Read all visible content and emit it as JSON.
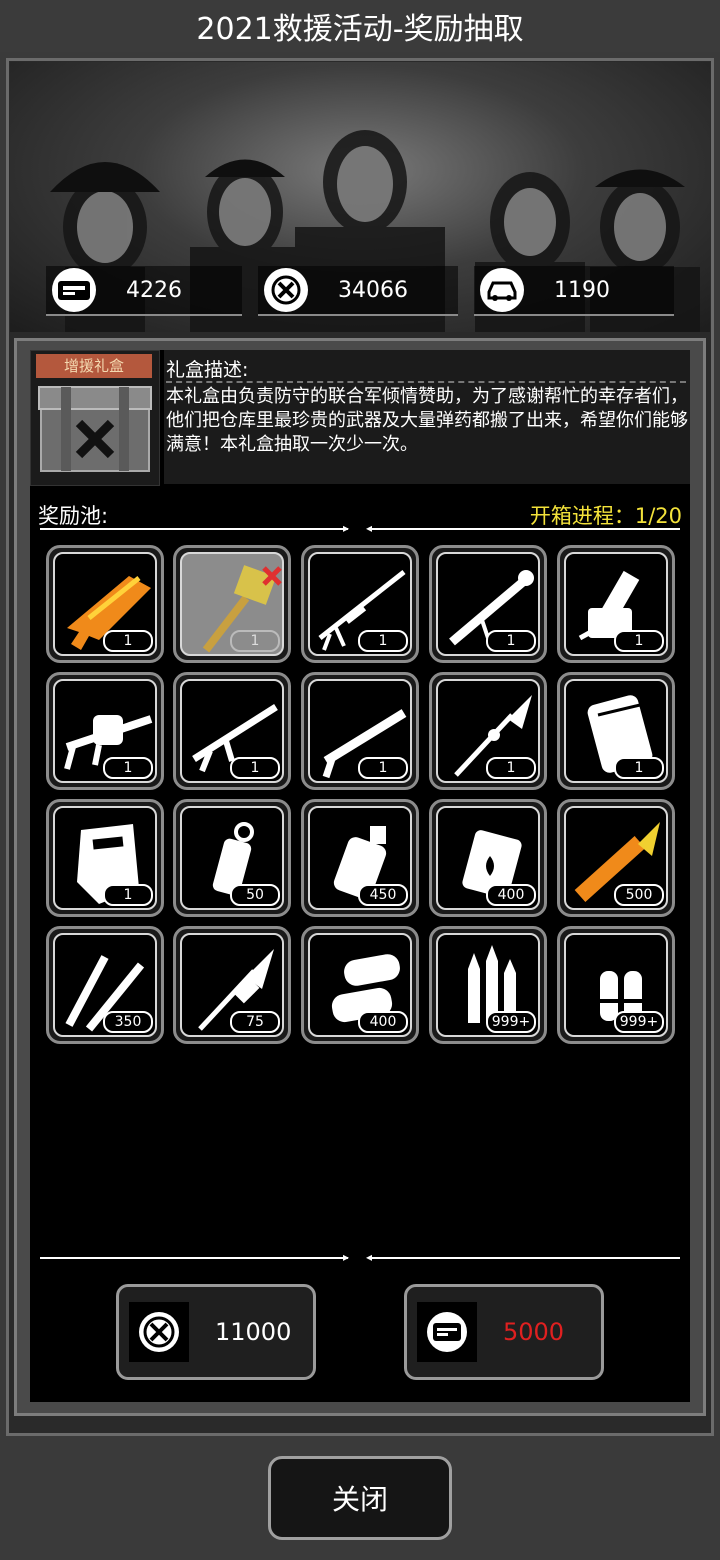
{
  "title": "2021救援活动-奖励抽取",
  "resources": [
    {
      "icon": "ticket-icon",
      "value": "4226"
    },
    {
      "icon": "crossed-swords-icon",
      "value": "34066"
    },
    {
      "icon": "vehicle-icon",
      "value": "1190"
    }
  ],
  "gift": {
    "tag": "增援礼盒",
    "desc_title": "礼盒描述:",
    "desc_text": "本礼盒由负责防守的联合军倾情赞助，为了感谢帮忙的幸存者们，他们把仓库里最珍贵的武器及大量弹药都搬了出来，希望你们能够满意！本礼盒抽取一次少一次。"
  },
  "pool": {
    "label": "奖励池:",
    "progress": "开箱进程：1/20",
    "items": [
      {
        "name": "orange-blaster-icon",
        "count": "1"
      },
      {
        "name": "golden-hammer-icon",
        "count": "1",
        "claimed": true
      },
      {
        "name": "sniper-rifle-icon",
        "count": "1"
      },
      {
        "name": "rocket-launcher-icon",
        "count": "1"
      },
      {
        "name": "minigun-icon",
        "count": "1"
      },
      {
        "name": "grenade-launcher-icon",
        "count": "1"
      },
      {
        "name": "assault-rifle-icon",
        "count": "1"
      },
      {
        "name": "shotgun-icon",
        "count": "1"
      },
      {
        "name": "spear-icon",
        "count": "1"
      },
      {
        "name": "armor-pack-icon",
        "count": "1"
      },
      {
        "name": "riot-shield-icon",
        "count": "1"
      },
      {
        "name": "frag-grenade-icon",
        "count": "50"
      },
      {
        "name": "incendiary-grenade-icon",
        "count": "450"
      },
      {
        "name": "fire-mine-icon",
        "count": "400"
      },
      {
        "name": "rocket-ammo-icon",
        "count": "500"
      },
      {
        "name": "rifle-rounds-icon",
        "count": "350"
      },
      {
        "name": "rpg-rocket-icon",
        "count": "75"
      },
      {
        "name": "shotgun-shells-icon",
        "count": "400"
      },
      {
        "name": "rifle-bullets-icon",
        "count": "999+"
      },
      {
        "name": "pistol-bullets-icon",
        "count": "999+"
      }
    ]
  },
  "costs": [
    {
      "icon": "crossed-swords-icon",
      "value": "11000",
      "color": "#ffffff"
    },
    {
      "icon": "ticket-icon",
      "value": "5000",
      "color": "#e02020"
    }
  ],
  "close_label": "关闭"
}
